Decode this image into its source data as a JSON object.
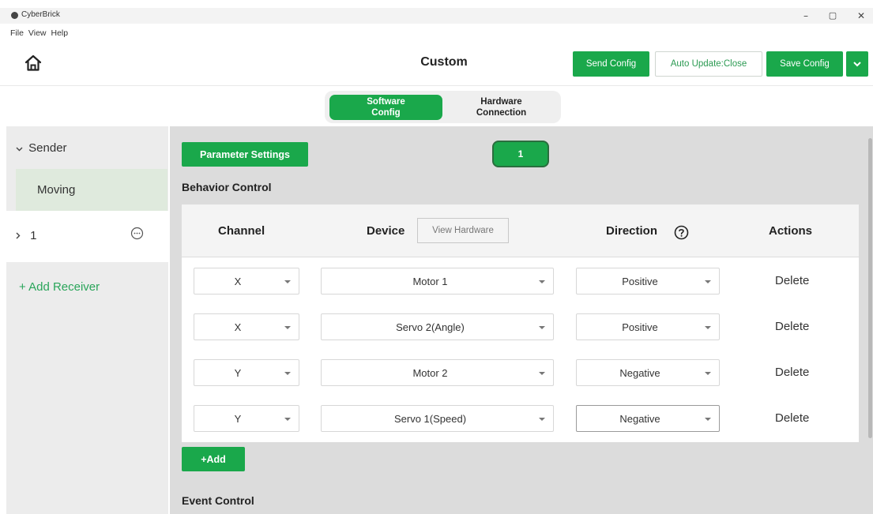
{
  "window": {
    "title": "CyberBrick",
    "minimize": "–",
    "maximize": "▢",
    "close": "✕"
  },
  "menu": [
    "File",
    "View",
    "Help"
  ],
  "header": {
    "title": "Custom",
    "send_config": "Send Config",
    "auto_update": "Auto Update:Close",
    "save_config": "Save Config"
  },
  "tabs": [
    {
      "line1": "Software",
      "line2": "Config",
      "active": true
    },
    {
      "line1": "Hardware",
      "line2": "Connection",
      "active": false
    }
  ],
  "sidebar": {
    "sender": "Sender",
    "sender_child": "Moving",
    "receiver": "1",
    "add_receiver": "+ Add Receiver"
  },
  "main": {
    "parameter_settings": "Parameter Settings",
    "page_chip": "1",
    "behavior_title": "Behavior Control",
    "event_title": "Event Control",
    "add_label": "+Add"
  },
  "table": {
    "headers": {
      "channel": "Channel",
      "device": "Device",
      "direction": "Direction",
      "actions": "Actions"
    },
    "view_hardware": "View Hardware",
    "rows": [
      {
        "channel": "X",
        "device": "Motor 1",
        "direction": "Positive",
        "action": "Delete"
      },
      {
        "channel": "X",
        "device": "Servo 2(Angle)",
        "direction": "Positive",
        "action": "Delete"
      },
      {
        "channel": "Y",
        "device": "Motor 2",
        "direction": "Negative",
        "action": "Delete"
      },
      {
        "channel": "Y",
        "device": "Servo 1(Speed)",
        "direction": "Negative",
        "action": "Delete"
      }
    ]
  },
  "colors": {
    "accent": "#1aa84b",
    "link": "#2aa55a",
    "selected_bg": "#dfeadd"
  },
  "icons": [
    "home-icon",
    "chevron-down-icon",
    "chevron-right-icon",
    "more-icon",
    "help-icon",
    "caret-down-icon"
  ]
}
